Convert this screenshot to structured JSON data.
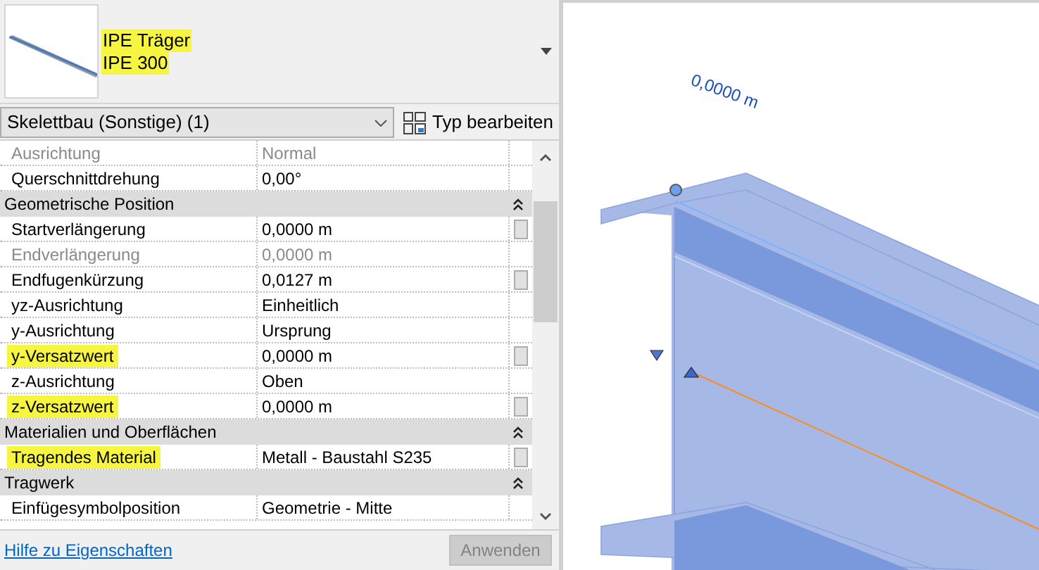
{
  "type_selector": {
    "family": "IPE Träger",
    "type": "IPE 300",
    "highlighted": true
  },
  "instance_filter": {
    "value": "Skelettbau (Sonstige) (1)"
  },
  "edit_type_button": {
    "label": "Typ bearbeiten"
  },
  "properties": [
    {
      "kind": "row",
      "name": "Ausrichtung",
      "value": "Normal",
      "disabled": true,
      "highlighted": false,
      "has_button": false
    },
    {
      "kind": "row",
      "name": "Querschnittdrehung",
      "value": "0,00°",
      "disabled": false,
      "highlighted": false,
      "has_button": false
    },
    {
      "kind": "group",
      "name": "Geometrische Position",
      "expanded": true
    },
    {
      "kind": "row",
      "name": "Startverlängerung",
      "value": "0,0000 m",
      "disabled": false,
      "highlighted": false,
      "has_button": true
    },
    {
      "kind": "row",
      "name": "Endverlängerung",
      "value": "0,0000 m",
      "disabled": true,
      "highlighted": false,
      "has_button": false
    },
    {
      "kind": "row",
      "name": "Endfugenkürzung",
      "value": "0,0127 m",
      "disabled": false,
      "highlighted": false,
      "has_button": true
    },
    {
      "kind": "row",
      "name": "yz-Ausrichtung",
      "value": "Einheitlich",
      "disabled": false,
      "highlighted": false,
      "has_button": false
    },
    {
      "kind": "row",
      "name": "y-Ausrichtung",
      "value": "Ursprung",
      "disabled": false,
      "highlighted": false,
      "has_button": false
    },
    {
      "kind": "row",
      "name": "y-Versatzwert",
      "value": "0,0000 m",
      "disabled": false,
      "highlighted": true,
      "has_button": true
    },
    {
      "kind": "row",
      "name": "z-Ausrichtung",
      "value": "Oben",
      "disabled": false,
      "highlighted": false,
      "has_button": false
    },
    {
      "kind": "row",
      "name": "z-Versatzwert",
      "value": "0,0000 m",
      "disabled": false,
      "highlighted": true,
      "has_button": true
    },
    {
      "kind": "group",
      "name": "Materialien und Oberflächen",
      "expanded": true
    },
    {
      "kind": "row",
      "name": "Tragendes Material",
      "value": "Metall - Baustahl S235",
      "disabled": false,
      "highlighted": true,
      "has_button": true
    },
    {
      "kind": "group",
      "name": "Tragwerk",
      "expanded": true
    },
    {
      "kind": "row",
      "name": "Einfügesymbolposition",
      "value": "Geometrie - Mitte",
      "disabled": false,
      "highlighted": false,
      "has_button": false
    }
  ],
  "help_link": {
    "label": "Hilfe zu Eigenschaften"
  },
  "apply_button": {
    "label": "Anwenden",
    "disabled": true
  },
  "viewport": {
    "dimension_label": "0,0000 m"
  }
}
